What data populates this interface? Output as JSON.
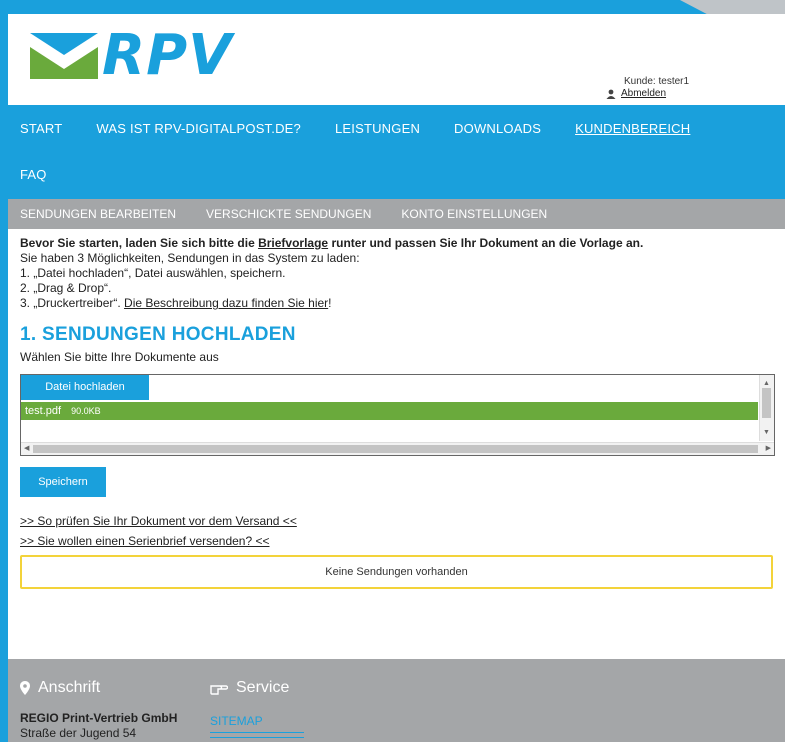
{
  "brand": {
    "logo_text": "RPV",
    "color": "#1aa0dc"
  },
  "user": {
    "customer_label": "Kunde: tester1",
    "logout_label": "Abmelden"
  },
  "nav": {
    "items": [
      {
        "label": "START"
      },
      {
        "label": "WAS IST RPV-DIGITALPOST.DE?"
      },
      {
        "label": "LEISTUNGEN"
      },
      {
        "label": "DOWNLOADS"
      },
      {
        "label": "KUNDENBEREICH"
      },
      {
        "label": "FAQ"
      }
    ],
    "active": "KUNDENBEREICH"
  },
  "subnav": {
    "items": [
      {
        "label": "SENDUNGEN BEARBEITEN"
      },
      {
        "label": "VERSCHICKTE SENDUNGEN"
      },
      {
        "label": "KONTO EINSTELLUNGEN"
      }
    ]
  },
  "intro": {
    "lead_before": "Bevor Sie starten, laden Sie sich bitte die ",
    "lead_link": "Briefvorlage",
    "lead_after": " runter und passen Sie Ihr Dokument an die Vorlage an.",
    "line1": "Sie haben 3 Möglichkeiten, Sendungen in das System zu laden:",
    "line2": "1. „Datei hochladen“, Datei auswählen, speichern.",
    "line3": "2. „Drag & Drop“.",
    "line4_before": "3. „Druckertreiber“. ",
    "line4_link": "Die Beschreibung dazu finden Sie hier",
    "line4_after": "!"
  },
  "upload": {
    "title": "1. SENDUNGEN HOCHLADEN",
    "subtitle": "Wählen Sie bitte Ihre Dokumente aus",
    "button_label": "Datei hochladen",
    "files": [
      {
        "name": "test.pdf",
        "size": "90.0KB"
      }
    ],
    "save_label": "Speichern"
  },
  "links": {
    "check": ">> So prüfen Sie Ihr Dokument vor dem Versand <<",
    "serial": ">> Sie wollen einen Serienbrief versenden? <<"
  },
  "notice": "Keine Sendungen vorhanden",
  "footer": {
    "address_heading": "Anschrift",
    "service_heading": "Service",
    "company": "REGIO Print-Vertrieb GmbH",
    "street": "Straße der Jugend 54",
    "sitemap_label": "SITEMAP"
  }
}
